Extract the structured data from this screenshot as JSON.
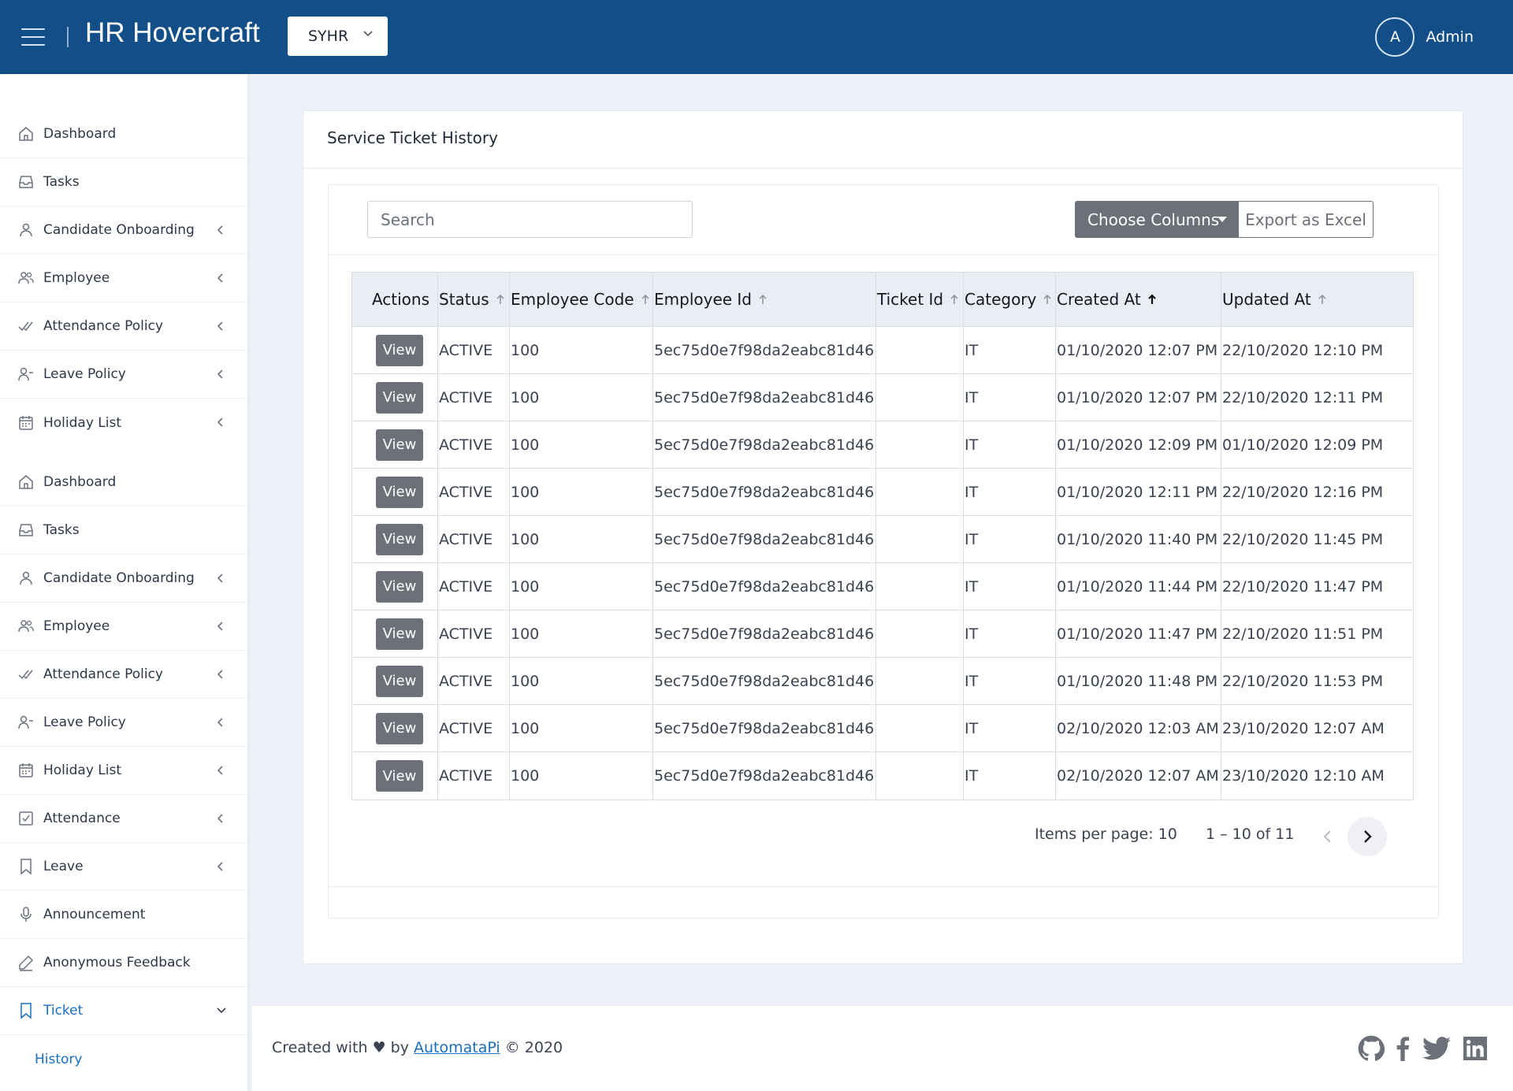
{
  "header": {
    "app_title": "HR Hovercraft",
    "org_select_value": "SYHR",
    "user_initial": "A",
    "user_name": "Admin"
  },
  "sidebar": {
    "items": [
      {
        "label": "Dashboard",
        "icon": "home-icon",
        "expandable": false
      },
      {
        "label": "Tasks",
        "icon": "inbox-icon",
        "expandable": false
      },
      {
        "label": "Candidate Onboarding",
        "icon": "user-icon",
        "expandable": true
      },
      {
        "label": "Employee",
        "icon": "users-icon",
        "expandable": true
      },
      {
        "label": "Attendance Policy",
        "icon": "double-check-icon",
        "expandable": true
      },
      {
        "label": "Leave Policy",
        "icon": "user-minus-icon",
        "expandable": true
      },
      {
        "label": "Holiday List",
        "icon": "calendar-icon",
        "expandable": true
      },
      {
        "label": "Dashboard",
        "icon": "home-icon",
        "expandable": false
      },
      {
        "label": "Tasks",
        "icon": "inbox-icon",
        "expandable": false
      },
      {
        "label": "Candidate Onboarding",
        "icon": "user-icon",
        "expandable": true
      },
      {
        "label": "Employee",
        "icon": "users-icon",
        "expandable": true
      },
      {
        "label": "Attendance Policy",
        "icon": "double-check-icon",
        "expandable": true
      },
      {
        "label": "Leave Policy",
        "icon": "user-minus-icon",
        "expandable": true
      },
      {
        "label": "Holiday List",
        "icon": "calendar-icon",
        "expandable": true
      },
      {
        "label": "Attendance",
        "icon": "check-square-icon",
        "expandable": true
      },
      {
        "label": "Leave",
        "icon": "bookmark-icon",
        "expandable": true
      },
      {
        "label": "Announcement",
        "icon": "microphone-icon",
        "expandable": false
      },
      {
        "label": "Anonymous Feedback",
        "icon": "edit-icon",
        "expandable": false
      },
      {
        "label": "Ticket",
        "icon": "bookmark-icon",
        "expandable": true,
        "active": true
      }
    ],
    "sub_item": "History"
  },
  "page": {
    "title": "Service Ticket History",
    "search_placeholder": "Search",
    "choose_columns_label": "Choose Columns",
    "export_label": "Export as Excel"
  },
  "table": {
    "columns": [
      "Actions",
      "Status",
      "Employee Code",
      "Employee Id",
      "Ticket Id",
      "Category",
      "Created At",
      "Updated At"
    ],
    "view_label": "View",
    "rows": [
      {
        "status": "ACTIVE",
        "employee_code": "100",
        "employee_id": "5ec75d0e7f98da2eabc81d46",
        "ticket_id": "",
        "category": "IT",
        "created_at": "01/10/2020 12:07 PM",
        "updated_at": "22/10/2020 12:10 PM"
      },
      {
        "status": "ACTIVE",
        "employee_code": "100",
        "employee_id": "5ec75d0e7f98da2eabc81d46",
        "ticket_id": "",
        "category": "IT",
        "created_at": "01/10/2020 12:07 PM",
        "updated_at": "22/10/2020 12:11 PM"
      },
      {
        "status": "ACTIVE",
        "employee_code": "100",
        "employee_id": "5ec75d0e7f98da2eabc81d46",
        "ticket_id": "",
        "category": "IT",
        "created_at": "01/10/2020 12:09 PM",
        "updated_at": "01/10/2020 12:09 PM"
      },
      {
        "status": "ACTIVE",
        "employee_code": "100",
        "employee_id": "5ec75d0e7f98da2eabc81d46",
        "ticket_id": "",
        "category": "IT",
        "created_at": "01/10/2020 12:11 PM",
        "updated_at": "22/10/2020 12:16 PM"
      },
      {
        "status": "ACTIVE",
        "employee_code": "100",
        "employee_id": "5ec75d0e7f98da2eabc81d46",
        "ticket_id": "",
        "category": "IT",
        "created_at": "01/10/2020 11:40 PM",
        "updated_at": "22/10/2020 11:45 PM"
      },
      {
        "status": "ACTIVE",
        "employee_code": "100",
        "employee_id": "5ec75d0e7f98da2eabc81d46",
        "ticket_id": "",
        "category": "IT",
        "created_at": "01/10/2020 11:44 PM",
        "updated_at": "22/10/2020 11:47 PM"
      },
      {
        "status": "ACTIVE",
        "employee_code": "100",
        "employee_id": "5ec75d0e7f98da2eabc81d46",
        "ticket_id": "",
        "category": "IT",
        "created_at": "01/10/2020 11:47 PM",
        "updated_at": "22/10/2020 11:51 PM"
      },
      {
        "status": "ACTIVE",
        "employee_code": "100",
        "employee_id": "5ec75d0e7f98da2eabc81d46",
        "ticket_id": "",
        "category": "IT",
        "created_at": "01/10/2020 11:48 PM",
        "updated_at": "22/10/2020 11:53 PM"
      },
      {
        "status": "ACTIVE",
        "employee_code": "100",
        "employee_id": "5ec75d0e7f98da2eabc81d46",
        "ticket_id": "",
        "category": "IT",
        "created_at": "02/10/2020 12:03 AM",
        "updated_at": "23/10/2020 12:07 AM"
      },
      {
        "status": "ACTIVE",
        "employee_code": "100",
        "employee_id": "5ec75d0e7f98da2eabc81d46",
        "ticket_id": "",
        "category": "IT",
        "created_at": "02/10/2020 12:07 AM",
        "updated_at": "23/10/2020 12:10 AM"
      }
    ]
  },
  "paginator": {
    "items_per_page": "Items per page: 10",
    "range": "1 – 10 of 11"
  },
  "footer": {
    "prefix": "Created with ♥ by",
    "link": "AutomataPi",
    "suffix": "© 2020",
    "social": [
      "github-icon",
      "facebook-icon",
      "twitter-icon",
      "linkedin-icon"
    ]
  },
  "colors": {
    "header_bg": "#124e87",
    "accent": "#1a6fbf",
    "button_gray": "#6b7079"
  }
}
